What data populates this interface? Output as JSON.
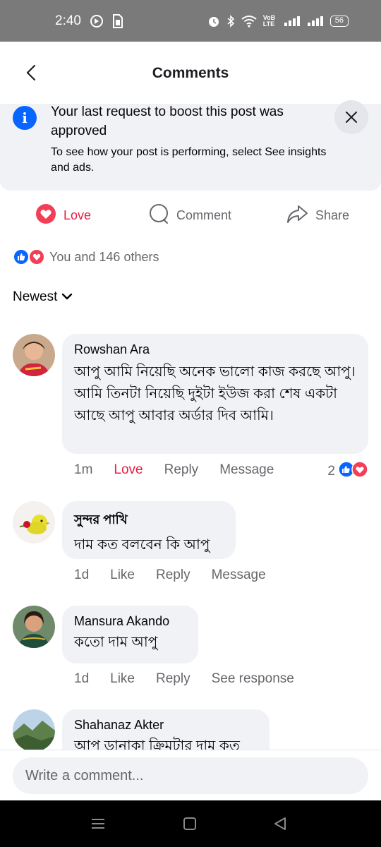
{
  "status_bar": {
    "time": "2:40",
    "network_label": "VoB LTE",
    "battery": "56"
  },
  "header": {
    "title": "Comments"
  },
  "boost_banner": {
    "title": "Your last request to boost this post was approved",
    "description": "To see how your post is performing, select See insights and ads."
  },
  "post_actions": {
    "love": "Love",
    "comment": "Comment",
    "share": "Share"
  },
  "reactions": {
    "summary": "You and 146 others"
  },
  "sort": {
    "label": "Newest"
  },
  "comments": [
    {
      "name": "Rowshan Ara",
      "text": "আপু আমি নিয়েছি অনেক ভালো কাজ করছে আপু। আমি তিনটা নিয়েছি দুইটা ইউজ করা শেষ একটা আছে আপু আবার অর্ডার দিব আমি।",
      "time": "1m",
      "reaction": "Love",
      "reply": "Reply",
      "message": "Message",
      "reaction_count": "2"
    },
    {
      "name": "সুন্দর পাখি",
      "text": "দাম কত বলবেন কি আপু",
      "time": "1d",
      "reaction": "Like",
      "reply": "Reply",
      "message": "Message"
    },
    {
      "name": "Mansura Akando",
      "text": "কতো দাম আপু",
      "time": "1d",
      "reaction": "Like",
      "reply": "Reply",
      "message": "See response"
    },
    {
      "name": "Shahanaz Akter",
      "text": "আপু ডানাকা ক্রিমটার দাম কত"
    }
  ],
  "composer": {
    "placeholder": "Write a comment..."
  },
  "colors": {
    "accent": "#0866ff",
    "love": "#e41e3f",
    "bubble": "#f0f2f5",
    "muted": "#65676b"
  }
}
